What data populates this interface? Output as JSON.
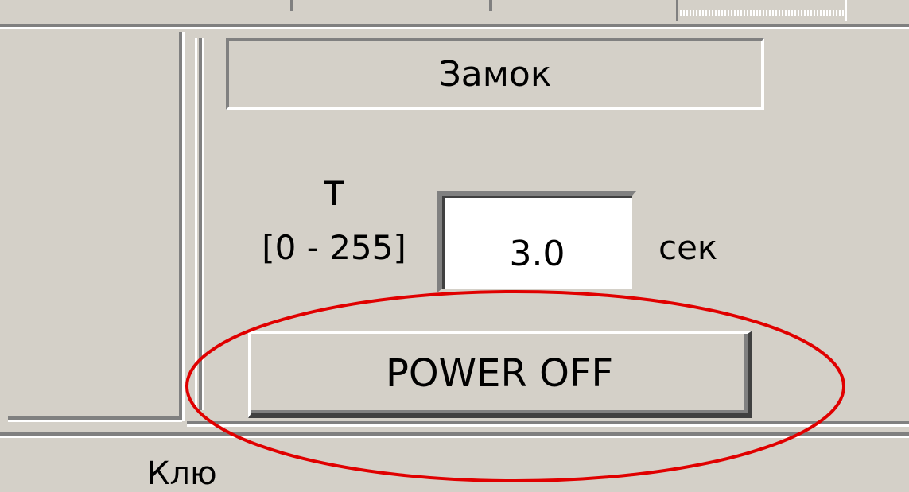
{
  "lock_panel": {
    "title": "Замок",
    "time_label": "T",
    "time_range": "[0 - 255]",
    "time_value": "3.0",
    "time_unit": "сек",
    "power_off_label": "POWER OFF"
  },
  "bottom_panel": {
    "title": "Клю"
  },
  "colors": {
    "face": "#d4d0c8",
    "shadow": "#808080",
    "highlight": "#ffffff",
    "annotation": "#e00000"
  }
}
